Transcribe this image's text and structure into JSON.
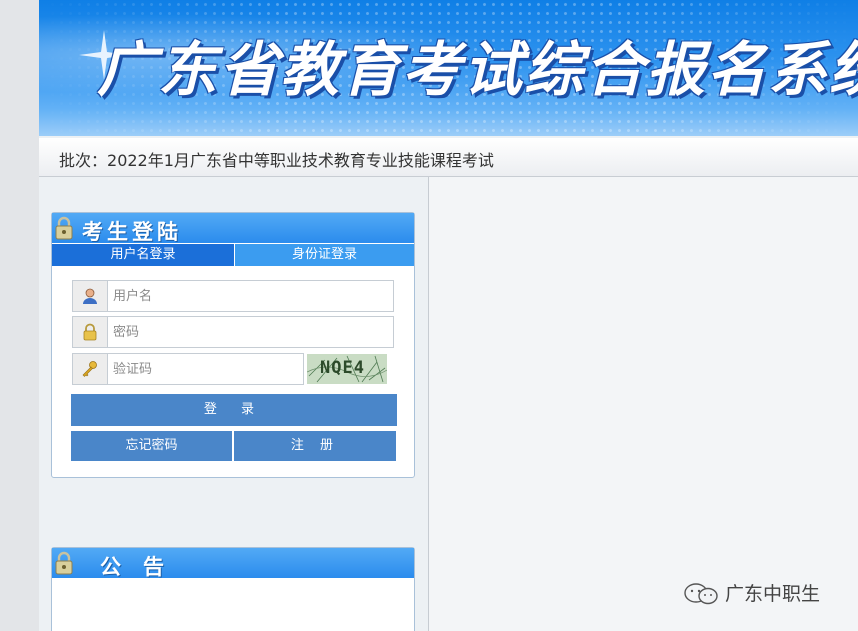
{
  "header": {
    "title": "广东省教育考试综合报名系统",
    "batch_label": "批次：",
    "batch_name": "2022年1月广东省中等职业技术教育专业技能课程考试"
  },
  "login": {
    "title": "考生登陆",
    "tabs": [
      {
        "label": "用户名登录",
        "active": true
      },
      {
        "label": "身份证登录",
        "active": false
      }
    ],
    "username_placeholder": "用户名",
    "password_placeholder": "密码",
    "captcha_placeholder": "验证码",
    "captcha_text": "NQE4",
    "login_button": "登 录",
    "forgot_button": "忘记密码",
    "register_button": "注 册"
  },
  "notice": {
    "title": "公告"
  },
  "watermark": {
    "text": "广东中职生"
  },
  "colors": {
    "banner_blue": "#2e93ef",
    "tab_active": "#1b6fd9",
    "tab_inactive": "#3b9cf0",
    "button_blue": "#4a86c9"
  },
  "icons": {
    "username": "user-icon",
    "password": "lock-icon",
    "captcha": "key-icon",
    "panel": "padlock-icon",
    "watermark": "wechat-icon"
  }
}
